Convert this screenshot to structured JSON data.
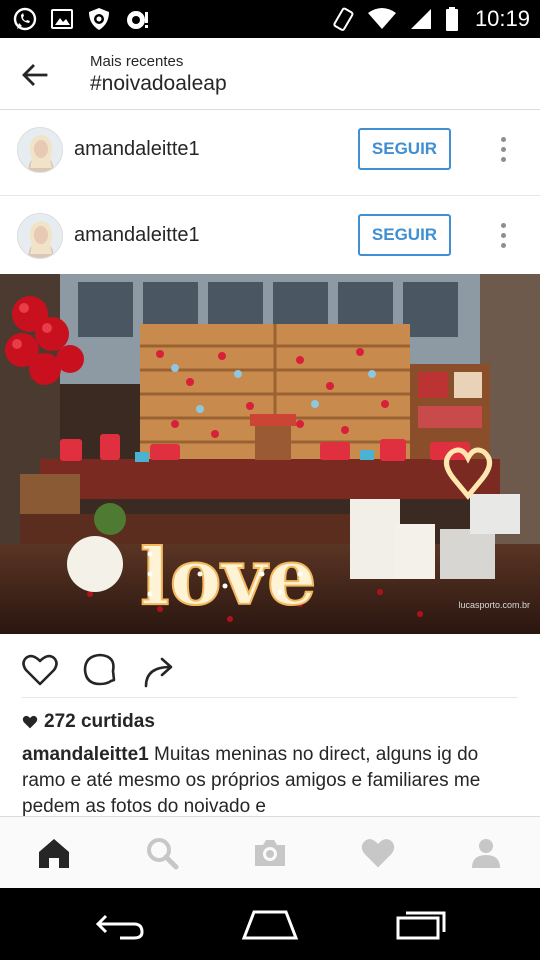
{
  "status_bar": {
    "time": "10:19",
    "left_icons": [
      "whatsapp-icon",
      "image-icon",
      "shield-icon",
      "eye-icon"
    ],
    "right_icons": [
      "vibrate-icon",
      "wifi-icon",
      "signal-icon",
      "battery-icon"
    ]
  },
  "header": {
    "subtitle": "Mais recentes",
    "title": "#noivadoaleap"
  },
  "rows": [
    {
      "username": "amandaleitte1",
      "follow_label": "SEGUIR"
    },
    {
      "username": "amandaleitte1",
      "follow_label": "SEGUIR"
    }
  ],
  "post": {
    "photo_letters": "love",
    "photo_credit": "lucasporto.com.br",
    "likes": "272 curtidas",
    "caption_user": "amandaleitte1",
    "caption_text": "Muitas meninas no direct, alguns ig do ramo e até mesmo os próprios amigos e familiares me pedem as fotos do noivado e"
  },
  "tabs": [
    "home-icon",
    "search-icon",
    "camera-icon",
    "heart-icon",
    "profile-icon"
  ],
  "colors": {
    "accent": "#3f8fd2",
    "text": "#262626",
    "muted": "#8e8e8e"
  }
}
